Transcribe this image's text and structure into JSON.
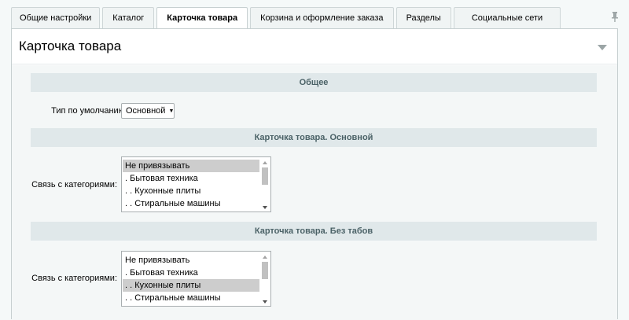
{
  "tabs": [
    {
      "label": "Общие настройки",
      "active": false
    },
    {
      "label": "Каталог",
      "active": false
    },
    {
      "label": "Карточка товара",
      "active": true
    },
    {
      "label": "Корзина и оформление заказа",
      "active": false
    },
    {
      "label": "Разделы",
      "active": false
    },
    {
      "label": "Социальные сети",
      "active": false
    }
  ],
  "pin_icon": "pin-icon",
  "panel": {
    "title": "Карточка товара",
    "collapse_icon": "triangle-down-icon"
  },
  "sections": {
    "general": {
      "title": "Общее",
      "default_type_label": "Тип по умолчанию:",
      "default_type_value": "Основной"
    },
    "main_card": {
      "title": "Карточка товара. Основной",
      "link_label": "Связь с категориями:",
      "options": [
        {
          "label": "Не привязывать",
          "selected": true
        },
        {
          "label": ". Бытовая техника",
          "selected": false
        },
        {
          "label": ". . Кухонные плиты",
          "selected": false
        },
        {
          "label": ". . Стиральные машины",
          "selected": false
        }
      ]
    },
    "no_tabs_card": {
      "title": "Карточка товара. Без табов",
      "link_label": "Связь с категориями:",
      "options": [
        {
          "label": "Не привязывать",
          "selected": false
        },
        {
          "label": ". Бытовая техника",
          "selected": false
        },
        {
          "label": ". . Кухонные плиты",
          "selected": true
        },
        {
          "label": ". . Стиральные машины",
          "selected": false
        }
      ]
    }
  }
}
